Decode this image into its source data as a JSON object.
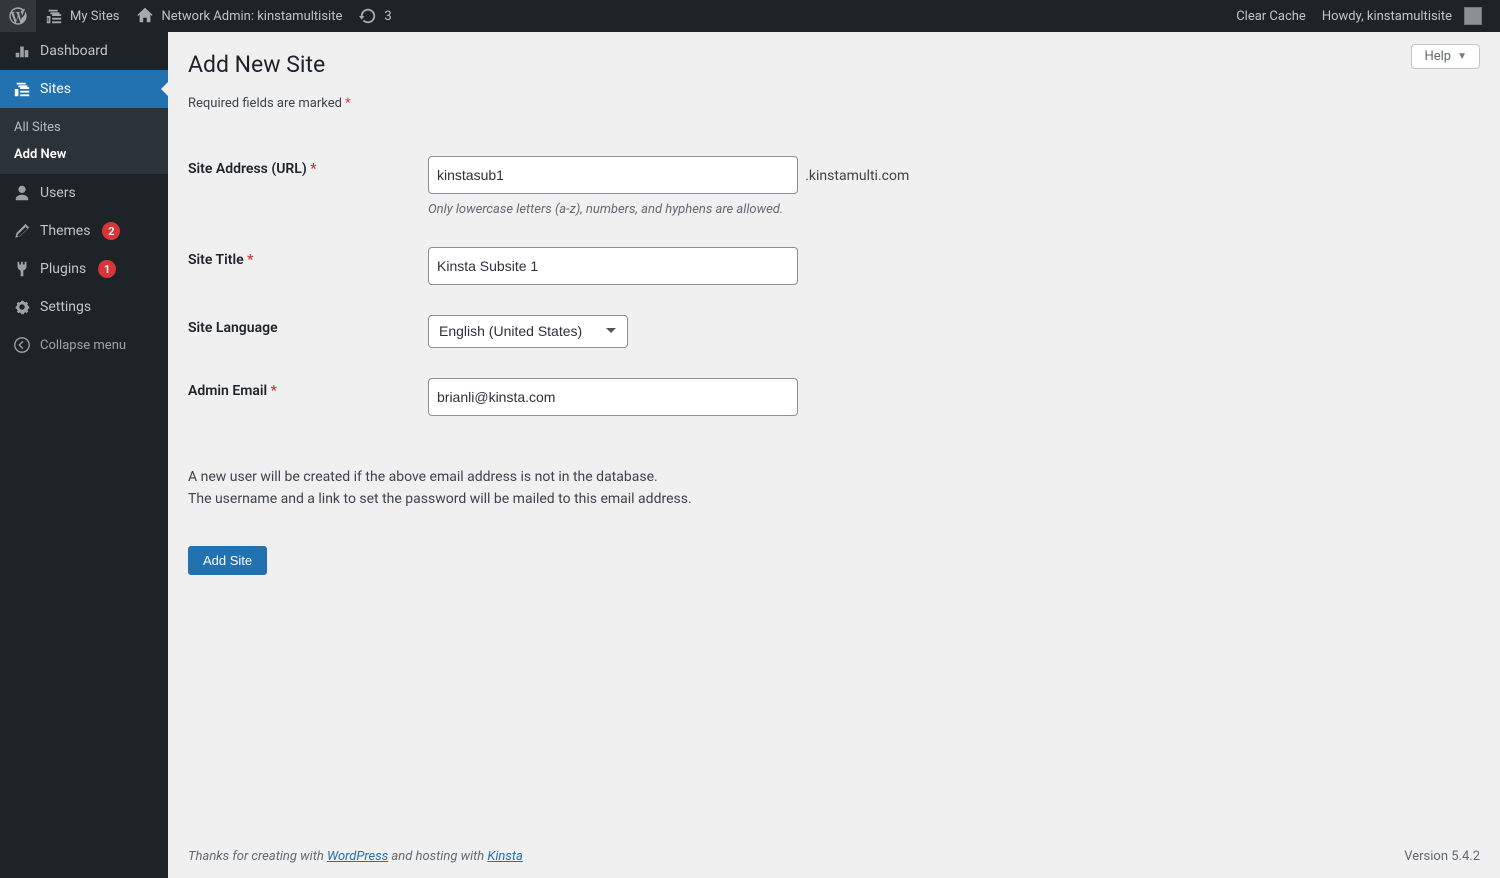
{
  "adminbar": {
    "my_sites": "My Sites",
    "network_admin": "Network Admin: kinstamultisite",
    "updates_count": "3",
    "clear_cache": "Clear Cache",
    "howdy": "Howdy, kinstamultisite"
  },
  "sidebar": {
    "dashboard": "Dashboard",
    "sites": "Sites",
    "all_sites": "All Sites",
    "add_new": "Add New",
    "users": "Users",
    "themes": "Themes",
    "themes_badge": "2",
    "plugins": "Plugins",
    "plugins_badge": "1",
    "settings": "Settings",
    "collapse": "Collapse menu"
  },
  "page": {
    "help": "Help",
    "title": "Add New Site",
    "required_note": "Required fields are marked ",
    "required_mark": "*"
  },
  "form": {
    "site_address_label": "Site Address (URL) ",
    "site_address_value": "kinstasub1",
    "domain_suffix": ".kinstamulti.com",
    "site_address_desc": "Only lowercase letters (a-z), numbers, and hyphens are allowed.",
    "site_title_label": "Site Title ",
    "site_title_value": "Kinsta Subsite 1",
    "site_language_label": "Site Language",
    "site_language_value": "English (United States)",
    "admin_email_label": "Admin Email ",
    "admin_email_value": "brianli@kinsta.com",
    "info_line1": "A new user will be created if the above email address is not in the database.",
    "info_line2": "The username and a link to set the password will be mailed to this email address.",
    "submit": "Add Site"
  },
  "footer": {
    "thanks_prefix": "Thanks for creating with ",
    "wordpress": "WordPress",
    "hosting_mid": " and hosting with ",
    "kinsta": "Kinsta",
    "version": "Version 5.4.2"
  }
}
